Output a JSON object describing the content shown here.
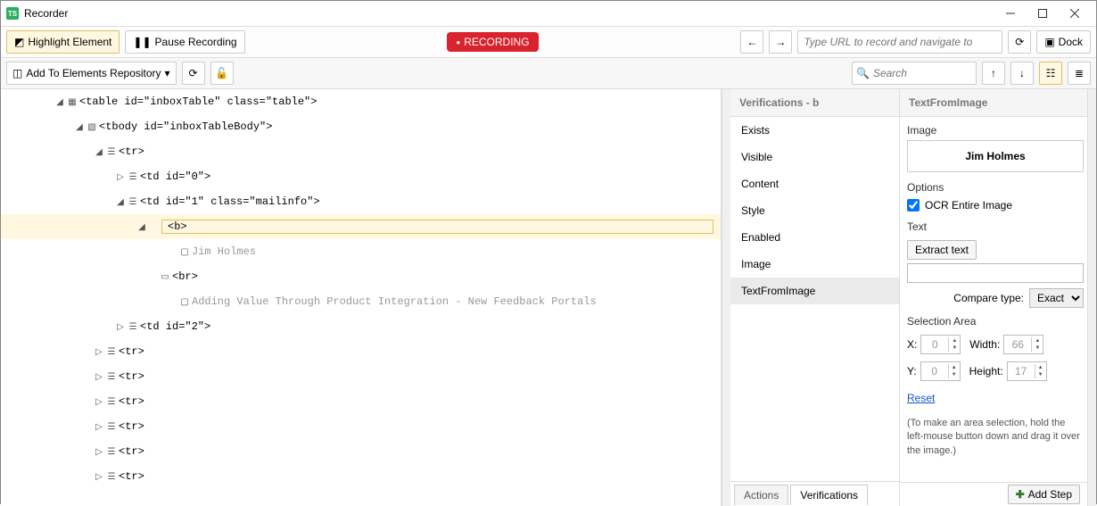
{
  "window": {
    "title": "Recorder",
    "app_badge": "TS"
  },
  "toolbar1": {
    "highlight": "Highlight Element",
    "pause": "Pause Recording",
    "recording": "RECORDING",
    "url_placeholder": "Type URL to record and navigate to",
    "dock": "Dock"
  },
  "toolbar2": {
    "add_repo": "Add To Elements Repository",
    "search_placeholder": "Search"
  },
  "dom": {
    "r0": "<table id=\"inboxTable\" class=\"table\">",
    "r1": "<tbody id=\"inboxTableBody\">",
    "r2": "<tr>",
    "r3": "<td id=\"0\">",
    "r4": "<td id=\"1\" class=\"mailinfo\">",
    "r5": "<b>",
    "r6": "Jim Holmes",
    "r7": "<br>",
    "r8": "Adding Value Through Product Integration - New Feedback Portals",
    "r9": "<td id=\"2\">",
    "r10": "<tr>",
    "r11": "<tr>",
    "r12": "<tr>",
    "r13": "<tr>",
    "r14": "<tr>",
    "r15": "<tr>"
  },
  "verifications": {
    "title": "Verifications - b",
    "items": [
      "Exists",
      "Visible",
      "Content",
      "Style",
      "Enabled",
      "Image",
      "TextFromImage"
    ]
  },
  "props": {
    "pane_title": "TextFromImage",
    "image_label": "Image",
    "preview_text": "Jim Holmes",
    "options_label": "Options",
    "ocr_label": "OCR Entire Image",
    "text_label": "Text",
    "extract_btn": "Extract text",
    "compare_label": "Compare type:",
    "compare_value": "Exact",
    "selection_label": "Selection Area",
    "x_label": "X:",
    "y_label": "Y:",
    "width_label": "Width:",
    "height_label": "Height:",
    "x_val": "0",
    "y_val": "0",
    "w_val": "66",
    "h_val": "17",
    "reset": "Reset",
    "hint": "(To make an area selection, hold the left-mouse button down and drag it over the image.)"
  },
  "tabs": {
    "actions": "Actions",
    "verifications": "Verifications",
    "add_step": "Add Step"
  }
}
